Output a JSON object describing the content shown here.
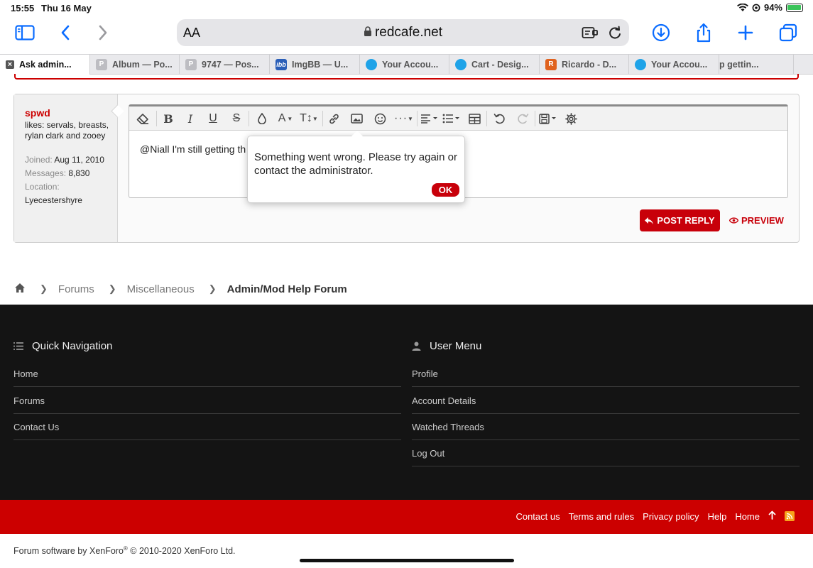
{
  "status": {
    "time": "15:55",
    "date": "Thu 16 May",
    "battery": "94%"
  },
  "browser": {
    "text_size_label": "AA",
    "domain": "redcafe.net",
    "tabs": [
      {
        "label": "Ask admin...",
        "fav": "×"
      },
      {
        "label": "Album — Po...",
        "fav": "P"
      },
      {
        "label": "9747 — Pos...",
        "fav": "P"
      },
      {
        "label": "ImgBB — U...",
        "fav": "ibb"
      },
      {
        "label": "Your Accou...",
        "fav": ""
      },
      {
        "label": "Cart - Desig...",
        "fav": ""
      },
      {
        "label": "Ricardo - D...",
        "fav": "R"
      },
      {
        "label": "Your Accou...",
        "fav": ""
      },
      {
        "label": "p gettin...",
        "fav": ""
      }
    ]
  },
  "user": {
    "name": "spwd",
    "likes": "likes: servals, breasts, rylan clark and zooey",
    "joined_label": "Joined:",
    "joined": "Aug 11, 2010",
    "messages_label": "Messages:",
    "messages": "8,830",
    "location_label": "Location:",
    "location": "Lyecestershyre"
  },
  "editor": {
    "text": "@Niall I'm still getting th"
  },
  "popup": {
    "message": "Something went wrong. Please try again or contact the administrator.",
    "ok": "OK"
  },
  "actions": {
    "post_reply": "POST REPLY",
    "preview": "PREVIEW"
  },
  "breadcrumb": {
    "items": [
      "Forums",
      "Miscellaneous"
    ],
    "current": "Admin/Mod Help Forum"
  },
  "footer": {
    "quick_nav": {
      "title": "Quick Navigation",
      "links": [
        "Home",
        "Forums",
        "Contact Us"
      ]
    },
    "user_menu": {
      "title": "User Menu",
      "links": [
        "Profile",
        "Account Details",
        "Watched Threads",
        "Log Out"
      ]
    },
    "bottom_links": [
      "Contact us",
      "Terms and rules",
      "Privacy policy",
      "Help",
      "Home"
    ],
    "copyright_prefix": "Forum software by XenForo",
    "copyright_mark": "®",
    "copyright_suffix": " © 2010-2020 XenForo Ltd."
  },
  "colors": {
    "accent": "#c8000a",
    "safari_blue": "#0a6cff",
    "footer_bg": "#141414"
  }
}
